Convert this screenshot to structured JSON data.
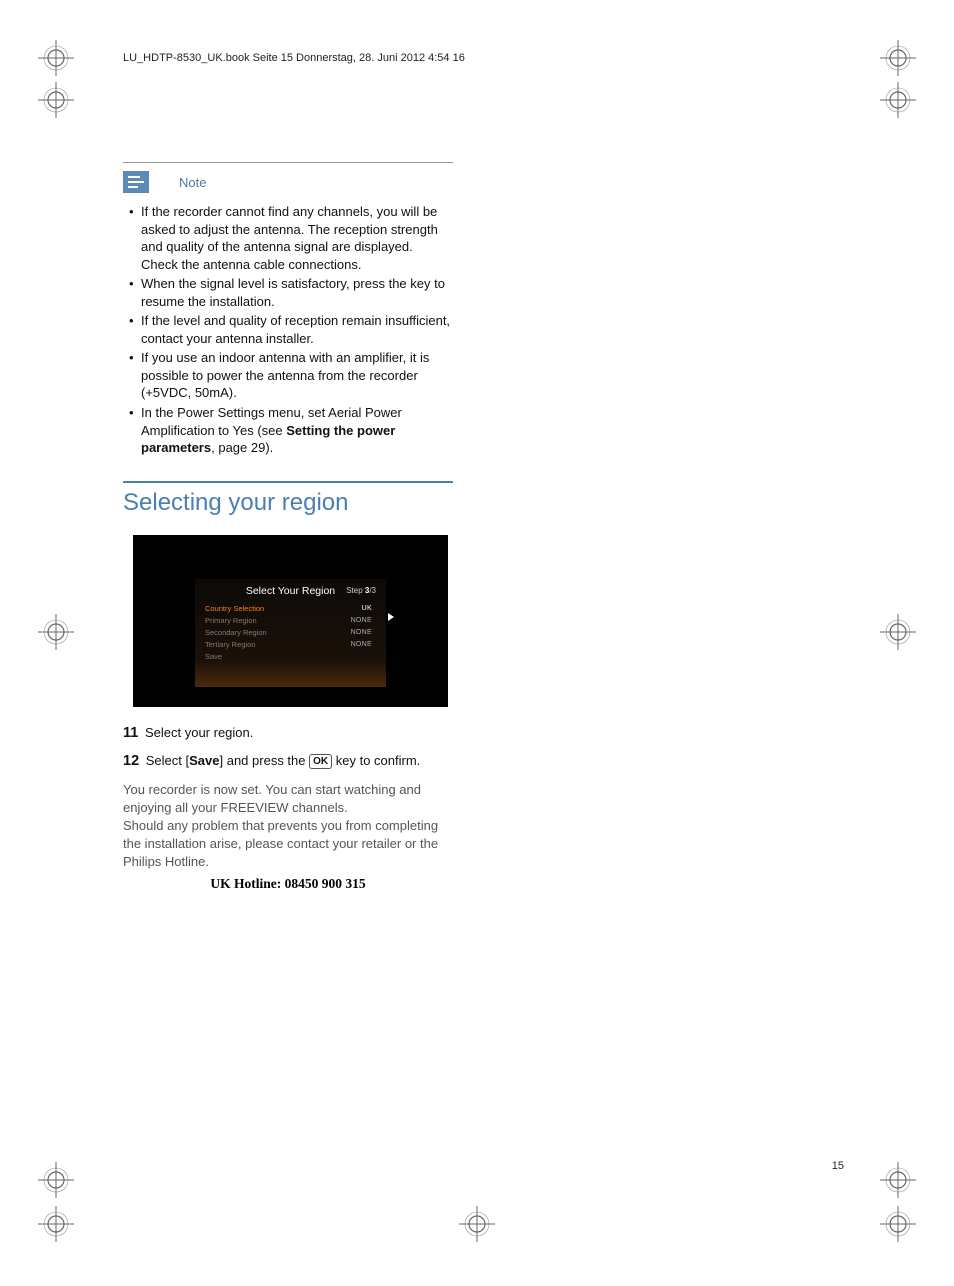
{
  "header": "LU_HDTP-8530_UK.book  Seite 15  Donnerstag, 28. Juni 2012  4:54 16",
  "note": {
    "label": "Note",
    "items": [
      "If the recorder cannot find any channels, you will be asked to adjust the antenna. The reception strength and quality of the antenna signal are displayed. Check the antenna cable connections.",
      "When the signal level is satisfactory, press the  key to resume the installation.",
      "If the level and quality of reception remain insufficient, contact your antenna installer.",
      "If you use an indoor antenna with an amplifier, it is possible to power the antenna from the recorder (+5VDC, 50mA).",
      {
        "pre": "In the Power Settings menu, set Aerial Power Amplification to Yes (see ",
        "bold": "Setting the power parameters",
        "post": ", page 29)."
      }
    ]
  },
  "section_title": "Selecting your region",
  "screenshot": {
    "title": "Select Your Region",
    "step_label": "Step ",
    "step_cur": "3",
    "step_total": "/3",
    "rows": [
      {
        "label": "Country Selection",
        "value": "UK",
        "selected": true
      },
      {
        "label": "Primary Region",
        "value": "NONE",
        "selected": false
      },
      {
        "label": "Secondary Region",
        "value": "NONE",
        "selected": false
      },
      {
        "label": "Tertiary Region",
        "value": "NONE",
        "selected": false
      },
      {
        "label": "Save",
        "value": "",
        "selected": false
      }
    ]
  },
  "steps": {
    "s11_num": "11",
    "s11_text": "Select your region.",
    "s12_num": "12",
    "s12_pre": "Select [",
    "s12_bold": "Save",
    "s12_mid": "] and press the ",
    "s12_ok": "OK",
    "s12_post": " key to confirm."
  },
  "body": {
    "p1": "You recorder is now set. You can start watching and enjoying all your FREEVIEW channels.",
    "p2": "Should any problem that prevents you from completing the installation arise, please contact your retailer or the Philips Hotline.",
    "hotline": "UK Hotline: 08450 900 315"
  },
  "page_number": "15"
}
